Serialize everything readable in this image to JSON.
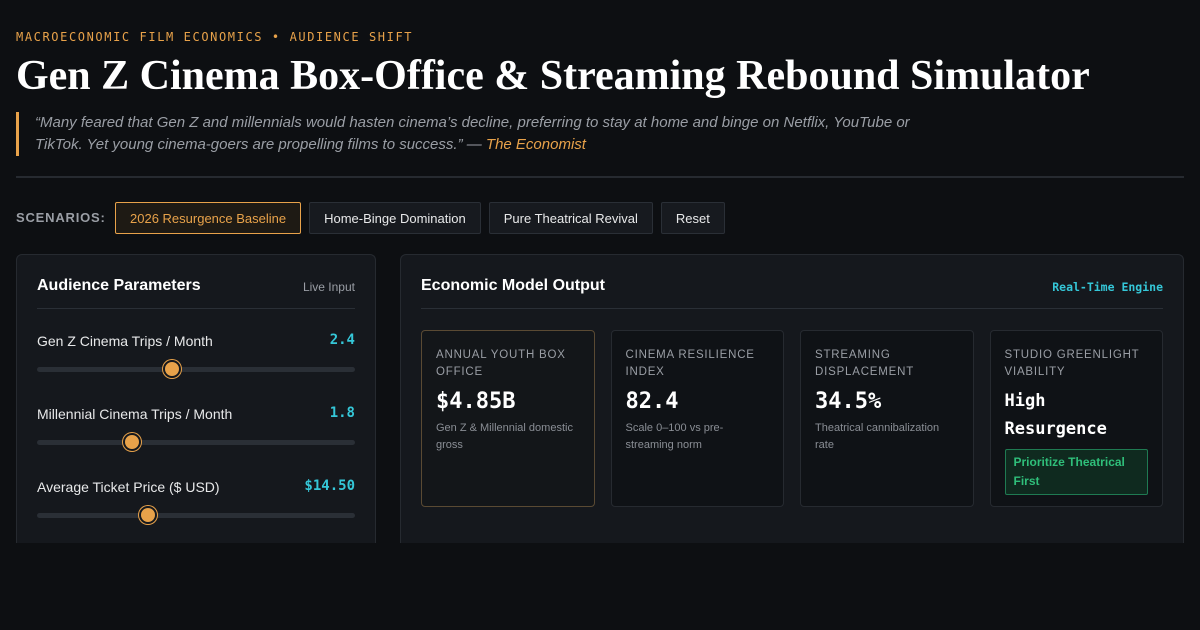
{
  "header": {
    "kicker": "MACROECONOMIC FILM ECONOMICS • AUDIENCE SHIFT",
    "title": "Gen Z Cinema Box-Office & Streaming Rebound Simulator",
    "quote": "“Many feared that Gen Z and millennials would hasten cinema’s decline, preferring to stay at home and binge on Netflix, YouTube or TikTok. Yet young cinema-goers are propelling films to success.” — ",
    "quote_source": "The Economist"
  },
  "scenarios": {
    "label": "SCENARIOS:",
    "buttons": [
      {
        "label": "2026 Resurgence Baseline",
        "active": true
      },
      {
        "label": "Home-Binge Domination",
        "active": false
      },
      {
        "label": "Pure Theatrical Revival",
        "active": false
      },
      {
        "label": "Reset",
        "active": false
      }
    ]
  },
  "parameters": {
    "title": "Audience Parameters",
    "tag": "Live Input",
    "items": [
      {
        "label": "Gen Z Cinema Trips / Month",
        "value": "2.4",
        "level": 0.425
      },
      {
        "label": "Millennial Cinema Trips / Month",
        "value": "1.8",
        "level": 0.3
      },
      {
        "label": "Average Ticket Price ($ USD)",
        "value": "$14.50",
        "level": 0.35
      }
    ]
  },
  "output": {
    "title": "Economic Model Output",
    "tag": "Real-Time Engine",
    "cards": [
      {
        "label": "Annual Youth Box Office",
        "value": "$4.85B",
        "sub": "Gen Z & Millennial domestic gross"
      },
      {
        "label": "Cinema Resilience Index",
        "value": "82.4",
        "sub": "Scale 0–100 vs pre-streaming norm"
      },
      {
        "label": "Streaming Displacement",
        "value": "34.5%",
        "sub": "Theatrical cannibalization rate"
      },
      {
        "label": "Studio Greenlight Viability",
        "value": "High Resurgence",
        "badge": "Prioritize Theatrical First"
      }
    ]
  },
  "colors": {
    "accent": "#e8a24a",
    "value": "#35c7d8",
    "positive": "#2fbf7a",
    "background": "#0d0f12"
  }
}
